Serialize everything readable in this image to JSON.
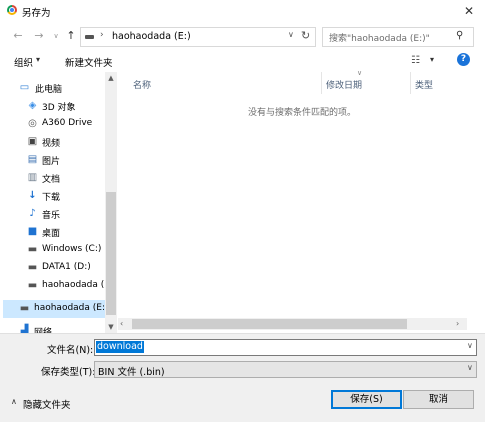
{
  "window": {
    "title": "另存为"
  },
  "nav": {
    "back": "←",
    "forward": "→",
    "up": "↑"
  },
  "address": {
    "path": "haohaodada (E:)",
    "separator": "›"
  },
  "search": {
    "placeholder": "搜索\"haohaodada (E:)\""
  },
  "toolbar": {
    "organize": "组织",
    "new_folder": "新建文件夹"
  },
  "sidebar": {
    "items": [
      {
        "label": "此电脑",
        "icon": "computer-icon"
      },
      {
        "label": "3D 对象",
        "icon": "3d-objects-icon"
      },
      {
        "label": "A360 Drive",
        "icon": "a360-drive-icon"
      },
      {
        "label": "视频",
        "icon": "video-icon"
      },
      {
        "label": "图片",
        "icon": "pictures-icon"
      },
      {
        "label": "文档",
        "icon": "documents-icon"
      },
      {
        "label": "下载",
        "icon": "download-icon"
      },
      {
        "label": "音乐",
        "icon": "music-icon"
      },
      {
        "label": "桌面",
        "icon": "desktop-icon"
      },
      {
        "label": "Windows (C:)",
        "icon": "windows-drive-icon"
      },
      {
        "label": "DATA1 (D:)",
        "icon": "drive-icon"
      },
      {
        "label": "haohaodada (E",
        "icon": "drive-icon"
      },
      {
        "label": "haohaodada (E:)",
        "icon": "drive-icon"
      },
      {
        "label": "网络",
        "icon": "network-icon"
      }
    ]
  },
  "columns": {
    "name": "名称",
    "modified": "修改日期",
    "type": "类型"
  },
  "file_list": {
    "empty_message": "没有与搜索条件匹配的项。"
  },
  "footer": {
    "filename_label": "文件名(N):",
    "filename_value": "download",
    "filetype_label": "保存类型(T):",
    "filetype_value": "BIN 文件 (.bin)",
    "hide_folders": "隐藏文件夹",
    "save": "保存(S)",
    "cancel": "取消"
  },
  "colors": {
    "accent": "#0078d7",
    "selection": "#cce8ff",
    "panel": "#f0f0f0"
  }
}
